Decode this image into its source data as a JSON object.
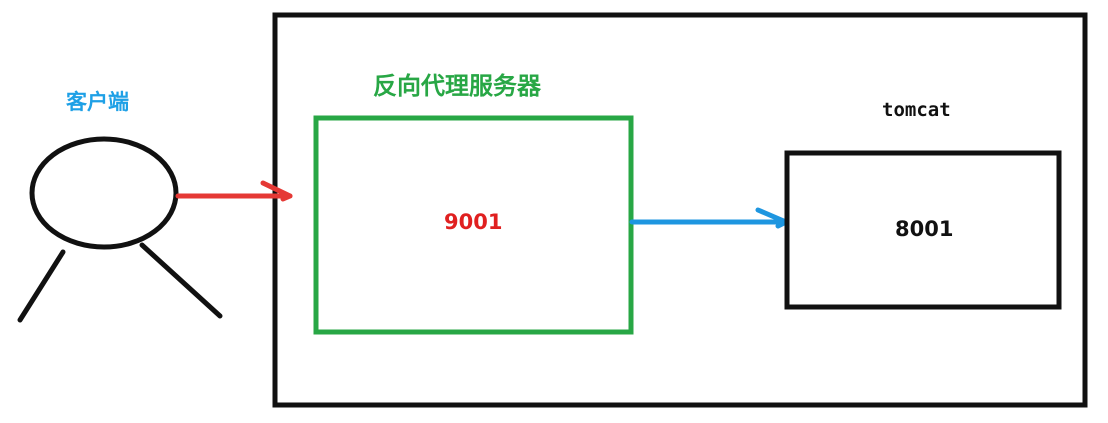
{
  "client": {
    "label": "客户端",
    "label_color": "#1ea0e6"
  },
  "proxy": {
    "title": "反向代理服务器",
    "port": "9001",
    "border_color": "#28a745",
    "port_color": "#e02020"
  },
  "tomcat": {
    "label": "tomcat",
    "port": "8001",
    "border_color": "#111111"
  },
  "edges": [
    {
      "from": "client",
      "to": "proxy",
      "color": "#e53935"
    },
    {
      "from": "proxy",
      "to": "tomcat",
      "color": "#1e96e0"
    }
  ],
  "icons": {
    "client_figure": "person-stick-figure-icon"
  }
}
